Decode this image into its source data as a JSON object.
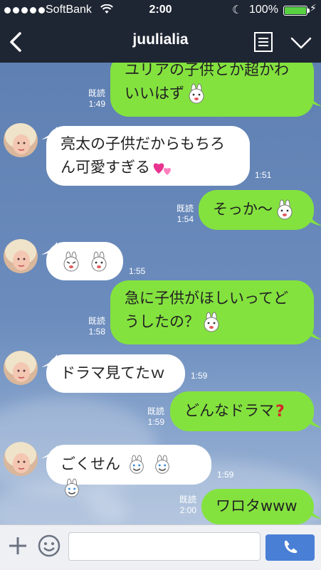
{
  "status_bar": {
    "carrier": "SoftBank",
    "time": "2:00",
    "battery": "100%",
    "battery_level": 1.0
  },
  "header": {
    "title": "juulialia"
  },
  "colors": {
    "sent": "#84e23f",
    "received": "#ffffff",
    "header": "#1f2633",
    "send_button": "#4a7fd6"
  },
  "messages": [
    {
      "side": "sent",
      "lines": [
        "ユリアの子供とか超かわ",
        "いいはず"
      ],
      "emoji": [
        "cony-sticker"
      ],
      "read": "既読",
      "time": "1:49"
    },
    {
      "side": "received",
      "lines": [
        "亮太の子供だからもちろ",
        "ん可愛すぎる"
      ],
      "emoji": [
        "two-hearts"
      ],
      "time": "1:51"
    },
    {
      "side": "sent",
      "lines": [
        "そっか〜"
      ],
      "emoji": [
        "cony-sticker"
      ],
      "read": "既読",
      "time": "1:54"
    },
    {
      "side": "received",
      "lines": [
        ""
      ],
      "emoji": [
        "cony-sticker",
        "cony-sticker"
      ],
      "time": "1:55"
    },
    {
      "side": "sent",
      "lines": [
        "急に子供がほしいってど",
        "うしたの？"
      ],
      "emoji": [
        "cony-sticker"
      ],
      "read": "既読",
      "time": "1:58"
    },
    {
      "side": "received",
      "lines": [
        "ドラマ見てたｗ"
      ],
      "emoji": [],
      "time": "1:59"
    },
    {
      "side": "sent",
      "lines": [
        "どんなドラマ"
      ],
      "emoji": [
        "red-question-mark"
      ],
      "read": "既読",
      "time": "1:59"
    },
    {
      "side": "received",
      "lines": [
        "ごくせん"
      ],
      "emoji": [
        "cony-sticker",
        "cony-sticker",
        "cony-sticker"
      ],
      "time": "1:59"
    },
    {
      "side": "sent",
      "lines": [
        "ワロタwww"
      ],
      "emoji": [],
      "read": "既読",
      "time": "2:00"
    }
  ],
  "input": {
    "placeholder": ""
  }
}
